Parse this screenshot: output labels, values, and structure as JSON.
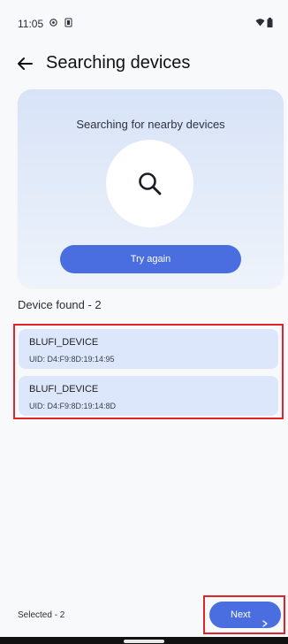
{
  "status_bar": {
    "time": "11:05",
    "icons": [
      "settings-icon",
      "battery-saver-icon",
      "wifi-icon",
      "battery-icon"
    ]
  },
  "app_bar": {
    "title": "Searching devices",
    "back_icon": "back-arrow-icon"
  },
  "search_card": {
    "title": "Searching for nearby devices",
    "icon": "search-icon",
    "button_label": "Try again"
  },
  "devices": {
    "found_label": "Device found - 2",
    "items": [
      {
        "name": "BLUFI_DEVICE",
        "uid": "UID: D4:F9:8D:19:14:95"
      },
      {
        "name": "BLUFI_DEVICE",
        "uid": "UID: D4:F9:8D:19:14:8D"
      }
    ]
  },
  "footer": {
    "selected_label": "Selected - 2",
    "next_label": "Next",
    "next_icon": "chevron-right-icon"
  },
  "colors": {
    "accent": "#4a6ee0",
    "card_bg": "#d7e3f7",
    "device_bg": "#dce7fb",
    "highlight": "#e0242a"
  }
}
